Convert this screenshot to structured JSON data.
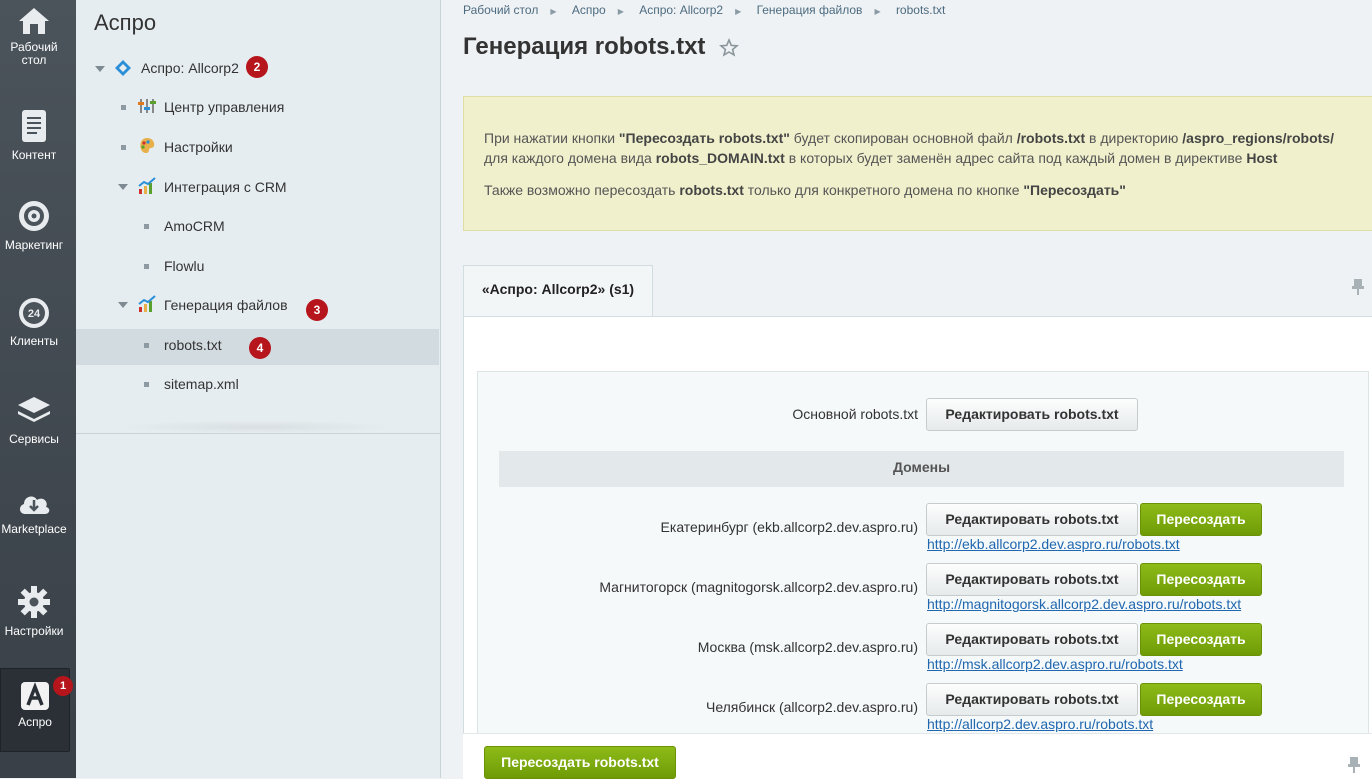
{
  "rail": {
    "items": [
      {
        "label": "Рабочий\nстол",
        "icon": "home-icon"
      },
      {
        "label": "Контент",
        "icon": "document-icon"
      },
      {
        "label": "Маркетинг",
        "icon": "target-icon"
      },
      {
        "label": "Клиенты",
        "icon": "clock-24-icon"
      },
      {
        "label": "Сервисы",
        "icon": "layers-icon"
      },
      {
        "label": "Marketplace",
        "icon": "cloud-download-icon"
      },
      {
        "label": "Настройки",
        "icon": "gear-icon"
      },
      {
        "label": "Аспро",
        "icon": "aspro-logo-icon"
      }
    ],
    "badge": "1"
  },
  "tree": {
    "title": "Аспро",
    "root": {
      "label": "Аспро: Allcorp2",
      "badge": "2"
    },
    "items": [
      {
        "label": "Центр управления"
      },
      {
        "label": "Настройки"
      },
      {
        "label": "Интеграция с CRM"
      },
      {
        "label": "AmoCRM"
      },
      {
        "label": "Flowlu"
      },
      {
        "label": "Генерация файлов",
        "badge": "3"
      },
      {
        "label": "robots.txt",
        "badge": "4"
      },
      {
        "label": "sitemap.xml"
      }
    ]
  },
  "breadcrumbs": [
    "Рабочий стол",
    "Аспро",
    "Аспро: Allcorp2",
    "Генерация файлов",
    "robots.txt"
  ],
  "page_title": "Генерация robots.txt",
  "note": {
    "line1_a": "При нажатии кнопки ",
    "line1_b": "\"Пересоздать robots.txt\"",
    "line1_c": " будет скопирован основной файл ",
    "line1_d": "/robots.txt",
    "line1_e": " в директорию ",
    "line1_f": "/aspro_regions/robots/",
    "line2_a": "для каждого домена вида ",
    "line2_b": "robots_DOMAIN.txt",
    "line2_c": " в которых будет заменён адрес сайта под каждый домен в директиве ",
    "line2_d": "Host",
    "line3_a": "Также возможно пересоздать ",
    "line3_b": "robots.txt",
    "line3_c": " только для конкретного домена по кнопке ",
    "line3_d": "\"Пересоздать\""
  },
  "tab_label": "«Аспро: Allcorp2» (s1)",
  "main_robots": {
    "label": "Основной robots.txt",
    "button": "Редактировать robots.txt"
  },
  "domains_header": "Домены",
  "domains": [
    {
      "label": "Екатеринбург (ekb.allcorp2.dev.aspro.ru)",
      "edit": "Редактировать robots.txt",
      "regen": "Пересоздать",
      "url": "http://ekb.allcorp2.dev.aspro.ru/robots.txt"
    },
    {
      "label": "Магнитогорск (magnitogorsk.allcorp2.dev.aspro.ru)",
      "edit": "Редактировать robots.txt",
      "regen": "Пересоздать",
      "url": "http://magnitogorsk.allcorp2.dev.aspro.ru/robots.txt"
    },
    {
      "label": "Москва (msk.allcorp2.dev.aspro.ru)",
      "edit": "Редактировать robots.txt",
      "regen": "Пересоздать",
      "url": "http://msk.allcorp2.dev.aspro.ru/robots.txt"
    },
    {
      "label": "Челябинск (allcorp2.dev.aspro.ru)",
      "edit": "Редактировать robots.txt",
      "regen": "Пересоздать",
      "url": "http://allcorp2.dev.aspro.ru/robots.txt"
    }
  ],
  "footer_button": "Пересоздать robots.txt"
}
